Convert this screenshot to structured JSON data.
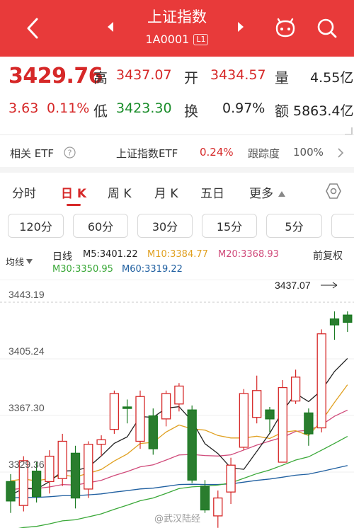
{
  "header": {
    "title": "上证指数",
    "code": "1A0001",
    "badge": "L1",
    "bg_color": "#e83a3a"
  },
  "quote": {
    "price": "3429.76",
    "change": "3.63",
    "change_pct": "0.11%",
    "high_label": "高",
    "high": "3437.07",
    "open_label": "开",
    "open": "3434.57",
    "volume_label": "量",
    "volume": "4.55亿",
    "low_label": "低",
    "low": "3423.30",
    "turnover_label": "换",
    "turnover": "0.97%",
    "amount_label": "额",
    "amount": "5863.4亿"
  },
  "etf": {
    "label": "相关 ETF",
    "name": "上证指数ETF",
    "pct": "0.24%",
    "tracking_label": "跟踪度",
    "tracking": "100%"
  },
  "tabs": [
    "分时",
    "日 K",
    "周 K",
    "月 K",
    "五日",
    "更多"
  ],
  "minute_buttons": [
    "120分",
    "60分",
    "30分",
    "15分",
    "5分"
  ],
  "ma": {
    "selector": "均线",
    "day_label": "日线",
    "m5": "M5:3401.22",
    "m10": "M10:3384.77",
    "m20": "M20:3368.93",
    "m30": "M30:3350.95",
    "m60": "M60:3319.22",
    "adjust": "前复权",
    "colors": {
      "m5": "#222222",
      "m10": "#e0a020",
      "m20": "#d04a7a",
      "m30": "#3aa838",
      "m60": "#1f5fa0"
    }
  },
  "chart_data": {
    "type": "candlestick",
    "y_ticks": [
      "3443.19",
      "3405.24",
      "3367.30",
      "3329.36"
    ],
    "y_tick_values": [
      3443.19,
      3405.24,
      3367.3,
      3329.36
    ],
    "max_annotation": "3437.07",
    "candles": [
      {
        "o": 3323,
        "c": 3310,
        "h": 3328,
        "l": 3302
      },
      {
        "o": 3307,
        "c": 3337,
        "h": 3340,
        "l": 3303
      },
      {
        "o": 3330,
        "c": 3313,
        "h": 3336,
        "l": 3309
      },
      {
        "o": 3323,
        "c": 3340,
        "h": 3344,
        "l": 3315
      },
      {
        "o": 3325,
        "c": 3350,
        "h": 3355,
        "l": 3320
      },
      {
        "o": 3342,
        "c": 3312,
        "h": 3347,
        "l": 3305
      },
      {
        "o": 3318,
        "c": 3348,
        "h": 3350,
        "l": 3312
      },
      {
        "o": 3348,
        "c": 3351,
        "h": 3354,
        "l": 3340
      },
      {
        "o": 3358,
        "c": 3382,
        "h": 3384,
        "l": 3355
      },
      {
        "o": 3373,
        "c": 3372,
        "h": 3378,
        "l": 3362
      },
      {
        "o": 3350,
        "c": 3380,
        "h": 3384,
        "l": 3345
      },
      {
        "o": 3367,
        "c": 3345,
        "h": 3372,
        "l": 3341
      },
      {
        "o": 3365,
        "c": 3382,
        "h": 3384,
        "l": 3360
      },
      {
        "o": 3375,
        "c": 3387,
        "h": 3389,
        "l": 3370
      },
      {
        "o": 3371,
        "c": 3324,
        "h": 3374,
        "l": 3322
      },
      {
        "o": 3320,
        "c": 3304,
        "h": 3324,
        "l": 3302
      },
      {
        "o": 3300,
        "c": 3312,
        "h": 3317,
        "l": 3292
      },
      {
        "o": 3316,
        "c": 3334,
        "h": 3339,
        "l": 3308
      },
      {
        "o": 3346,
        "c": 3382,
        "h": 3385,
        "l": 3344
      },
      {
        "o": 3366,
        "c": 3384,
        "h": 3394,
        "l": 3362
      },
      {
        "o": 3371,
        "c": 3365,
        "h": 3373,
        "l": 3356
      },
      {
        "o": 3336,
        "c": 3386,
        "h": 3391,
        "l": 3336
      },
      {
        "o": 3377,
        "c": 3393,
        "h": 3398,
        "l": 3375
      },
      {
        "o": 3369,
        "c": 3355,
        "h": 3372,
        "l": 3347
      },
      {
        "o": 3359,
        "c": 3422,
        "h": 3425,
        "l": 3356
      },
      {
        "o": 3432,
        "c": 3428,
        "h": 3437.07,
        "l": 3418
      },
      {
        "o": 3434.57,
        "c": 3429.76,
        "h": 3437.07,
        "l": 3423.3
      }
    ]
  },
  "watermark": "@武汉陆经"
}
